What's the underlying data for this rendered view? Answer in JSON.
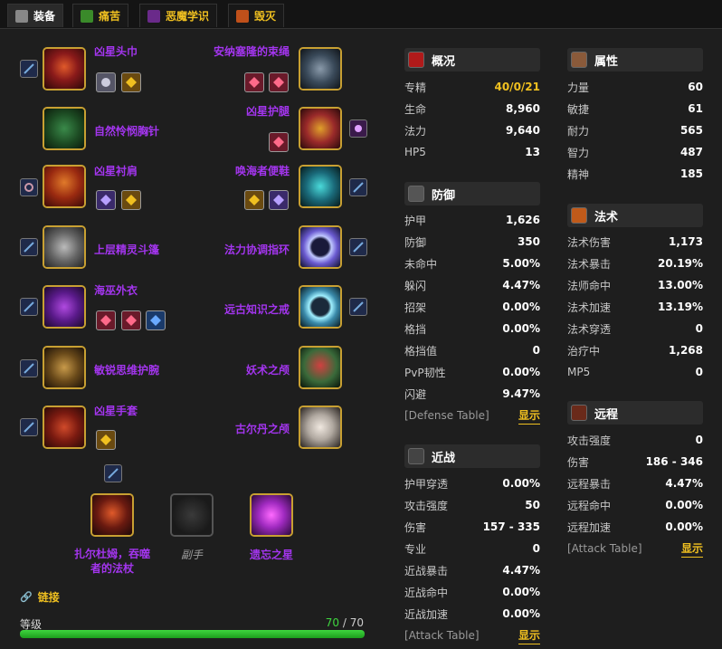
{
  "tabs": [
    {
      "label": "装备",
      "active": true,
      "icon": "armor-icon"
    },
    {
      "label": "痛苦",
      "active": false,
      "icon": "affliction-icon"
    },
    {
      "label": "恶魔学识",
      "active": false,
      "icon": "demonology-icon"
    },
    {
      "label": "毁灭",
      "active": false,
      "icon": "destruction-icon"
    }
  ],
  "gear": {
    "head": "凶星头巾",
    "neck": "自然怜悯胸针",
    "shoulder": "凶星衬肩",
    "back": "上层精灵斗篷",
    "chest": "海巫外衣",
    "wrist": "敏锐思维护腕",
    "hands": "凶星手套",
    "waist": "安纳塞隆的束绳",
    "legs": "凶星护腿",
    "feet": "唤海者便鞋",
    "ring1": "法力协调指环",
    "ring2": "远古知识之戒",
    "trinket1": "妖术之颅",
    "trinket2": "古尔丹之颅",
    "mainhand": "扎尔杜姆，吞噬者的法杖",
    "offhand": "副手",
    "ranged": "遗忘之星"
  },
  "links_label": "链接",
  "level": {
    "label": "等级",
    "current": "70",
    "max": "70",
    "separator": " / ",
    "fraction": 1.0
  },
  "panels": {
    "overview": {
      "title": "概况",
      "rows": [
        {
          "k": "专精",
          "v": "40/0/21"
        },
        {
          "k": "生命",
          "v": "8,960"
        },
        {
          "k": "法力",
          "v": "9,640"
        },
        {
          "k": "HP5",
          "v": "13"
        }
      ]
    },
    "defense": {
      "title": "防御",
      "rows": [
        {
          "k": "护甲",
          "v": "1,626"
        },
        {
          "k": "防御",
          "v": "350"
        },
        {
          "k": "未命中",
          "v": "5.00%"
        },
        {
          "k": "躲闪",
          "v": "4.47%"
        },
        {
          "k": "招架",
          "v": "0.00%"
        },
        {
          "k": "格挡",
          "v": "0.00%"
        },
        {
          "k": "格挡值",
          "v": "0"
        },
        {
          "k": "PvP韧性",
          "v": "0.00%"
        },
        {
          "k": "闪避",
          "v": "9.47%"
        }
      ],
      "table_label": "[Defense Table]",
      "show_label": "显示"
    },
    "melee": {
      "title": "近战",
      "rows": [
        {
          "k": "护甲穿透",
          "v": "0.00%"
        },
        {
          "k": "攻击强度",
          "v": "50"
        },
        {
          "k": "伤害",
          "v": "157 - 335"
        },
        {
          "k": "专业",
          "v": "0"
        },
        {
          "k": "近战暴击",
          "v": "4.47%"
        },
        {
          "k": "近战命中",
          "v": "0.00%"
        },
        {
          "k": "近战加速",
          "v": "0.00%"
        }
      ],
      "table_label": "[Attack Table]",
      "show_label": "显示"
    },
    "attributes": {
      "title": "属性",
      "rows": [
        {
          "k": "力量",
          "v": "60"
        },
        {
          "k": "敏捷",
          "v": "61"
        },
        {
          "k": "耐力",
          "v": "565"
        },
        {
          "k": "智力",
          "v": "487"
        },
        {
          "k": "精神",
          "v": "185"
        }
      ]
    },
    "spell": {
      "title": "法术",
      "rows": [
        {
          "k": "法术伤害",
          "v": "1,173"
        },
        {
          "k": "法术暴击",
          "v": "20.19%"
        },
        {
          "k": "法师命中",
          "v": "13.00%"
        },
        {
          "k": "法术加速",
          "v": "13.19%"
        },
        {
          "k": "法术穿透",
          "v": "0"
        },
        {
          "k": "治疗中",
          "v": "1,268"
        },
        {
          "k": "MP5",
          "v": "0"
        }
      ]
    },
    "ranged": {
      "title": "远程",
      "rows": [
        {
          "k": "攻击强度",
          "v": "0"
        },
        {
          "k": "伤害",
          "v": "186 - 346"
        },
        {
          "k": "远程暴击",
          "v": "4.47%"
        },
        {
          "k": "远程命中",
          "v": "0.00%"
        },
        {
          "k": "远程加速",
          "v": "0.00%"
        }
      ],
      "table_label": "[Attack Table]",
      "show_label": "显示"
    }
  },
  "colors": {
    "epic": "#a335ee",
    "gold": "#f0c020",
    "level_bar": "#2fbf2f"
  }
}
